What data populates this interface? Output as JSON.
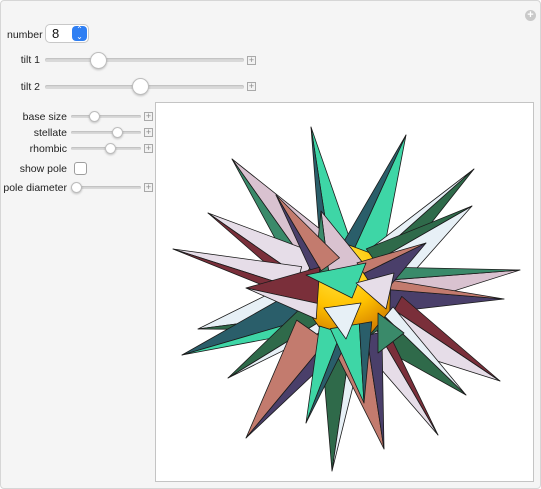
{
  "controls": {
    "number": {
      "label": "number",
      "value": "8",
      "stepper_glyph": "⌃⌄"
    },
    "tilt1": {
      "label": "tilt 1",
      "value": 0.27
    },
    "tilt2": {
      "label": "tilt 2",
      "value": 0.48
    },
    "base_size": {
      "label": "base size",
      "value": 0.33
    },
    "stellate": {
      "label": "stellate",
      "value": 0.66
    },
    "rhombic": {
      "label": "rhombic",
      "value": 0.56
    },
    "show_pole": {
      "label": "show pole",
      "checked": false
    },
    "pole_diameter": {
      "label": "pole diameter",
      "value": 0.08
    }
  },
  "add_glyph": "+",
  "colors": {
    "sphere_light": "#ffd21a",
    "sphere_dark": "#a84a00",
    "sphere_green": "#c6d600",
    "spike_colors": [
      "#3ed6a6",
      "#2f6a4a",
      "#c37b6e",
      "#e6dde8",
      "#d9c2d0",
      "#2a5e6a",
      "#e7f0f6",
      "#4a3f6a",
      "#7a2f3a",
      "#3a8a6a"
    ]
  },
  "graphic": {
    "name": "stellated polyhedron"
  }
}
